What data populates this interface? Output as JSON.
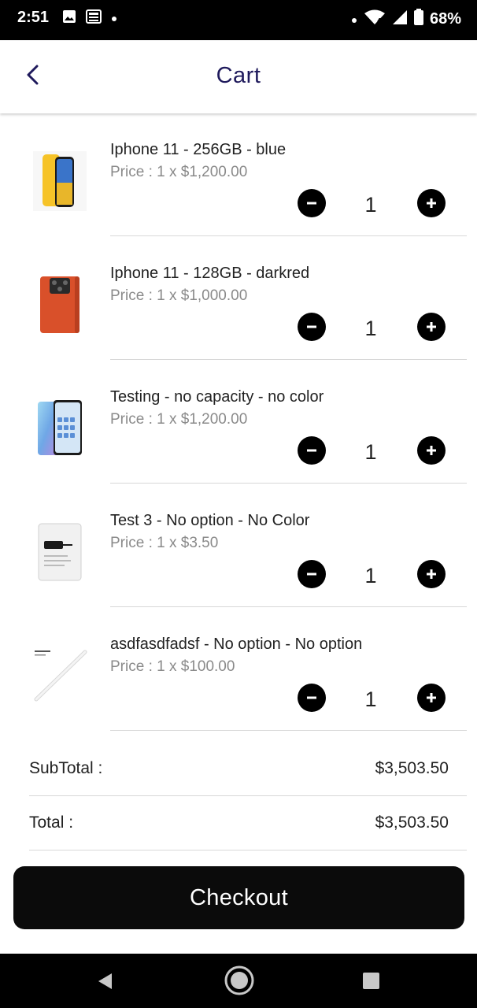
{
  "status_bar": {
    "time": "2:51",
    "battery": "68%",
    "left_icons": [
      "image-icon",
      "news-icon",
      "dot-icon"
    ],
    "right_icons": [
      "dot-icon",
      "wifi-icon",
      "signal-icon",
      "battery-icon"
    ]
  },
  "header": {
    "title": "Cart",
    "back_icon": "chevron-left-icon"
  },
  "cart": {
    "items": [
      {
        "name": "Iphone 11 - 256GB - blue",
        "price": "Price : 1 x $1,200.00",
        "quantity": "1",
        "thumb": "yellow-iphone"
      },
      {
        "name": "Iphone 11 - 128GB - darkred",
        "price": "Price : 1 x $1,000.00",
        "quantity": "1",
        "thumb": "orange-phone"
      },
      {
        "name": "Testing - no capacity - no color",
        "price": "Price : 1 x $1,200.00",
        "quantity": "1",
        "thumb": "gradient-phone"
      },
      {
        "name": "Test 3 - No option - No Color",
        "price": "Price : 1 x $3.50",
        "quantity": "1",
        "thumb": "accessory-box"
      },
      {
        "name": "asdfasdfadsf - No option - No option",
        "price": "Price : 1 x $100.00",
        "quantity": "1",
        "thumb": "stylus-pencil"
      }
    ]
  },
  "totals": {
    "subtotal_label": "SubTotal :",
    "subtotal_value": "$3,503.50",
    "total_label": "Total :",
    "total_value": "$3,503.50"
  },
  "checkout": {
    "label": "Checkout"
  },
  "nav_bar": {
    "icons": [
      "nav-back-icon",
      "nav-home-icon",
      "nav-recents-icon"
    ]
  }
}
